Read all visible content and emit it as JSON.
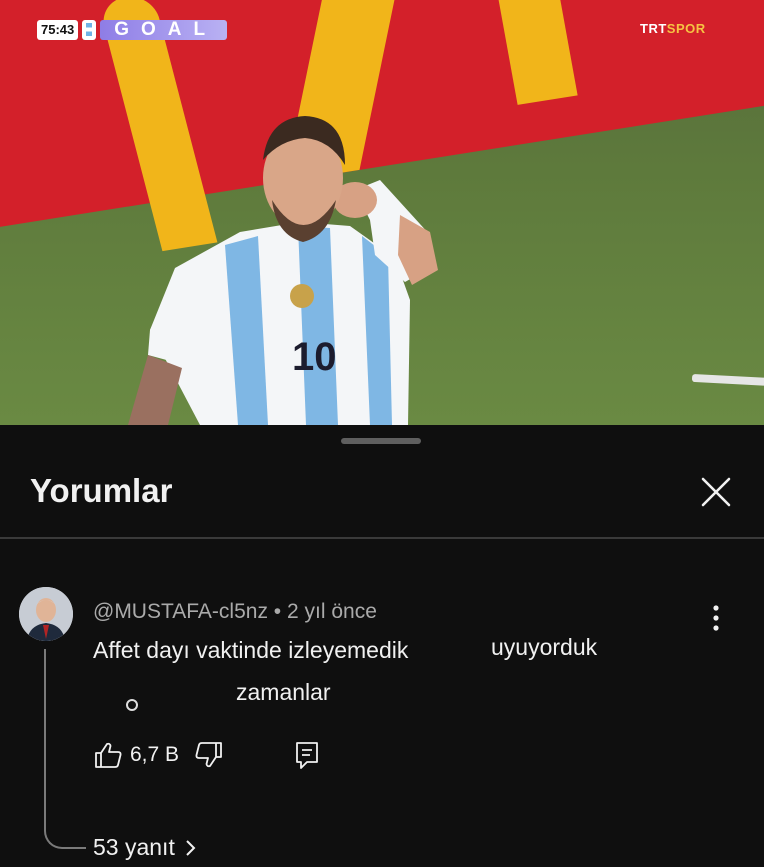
{
  "video": {
    "clock": "75:43",
    "banner": "GOAL",
    "broadcaster": {
      "part1": "TRT",
      "part2": "SPOR"
    },
    "jersey_number": "10"
  },
  "comments_panel": {
    "title": "Yorumlar",
    "close_icon": "close-icon",
    "comment": {
      "author": "@MUSTAFA-cl5nz",
      "separator": "•",
      "time": "2 yıl önce",
      "text": "Affet dayı vaktinde izleyemedik",
      "overlay_text_1": "uyuyorduk",
      "overlay_text_2": "zamanlar",
      "likes": "6,7 B",
      "like_icon": "thumbs-up-icon",
      "dislike_icon": "thumbs-down-icon",
      "reply_icon": "reply-icon",
      "more_icon": "more-vert-icon",
      "replies_label": "53 yanıt",
      "replies_icon": "chevron-right-icon"
    }
  },
  "colors": {
    "background": "#0f0f0f",
    "text": "#f1f1f1",
    "secondary_text": "#aaaaaa",
    "ad_red": "#d3202a",
    "ad_yellow": "#f1b51a"
  }
}
